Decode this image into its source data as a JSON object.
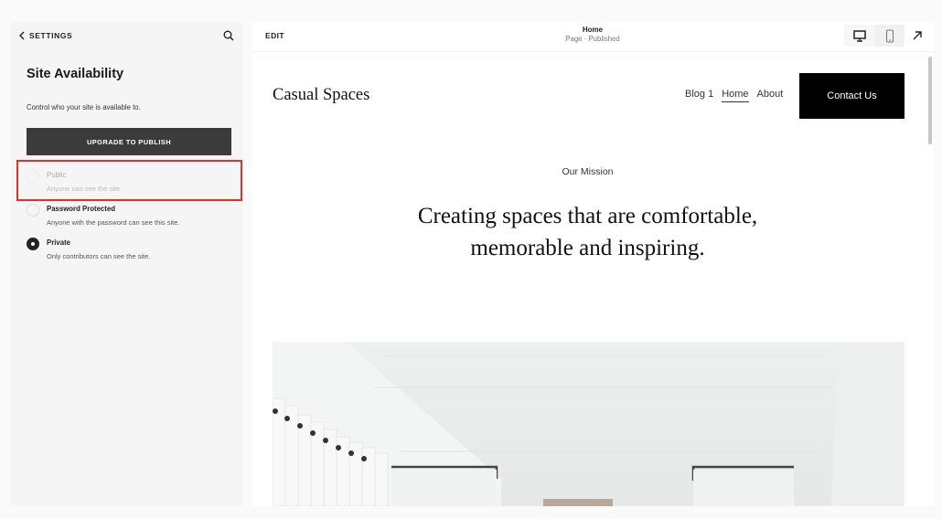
{
  "sidebar": {
    "back_label": "SETTINGS",
    "title": "Site Availability",
    "description": "Control who your site is available to.",
    "upgrade_label": "UPGRADE TO PUBLISH",
    "options": [
      {
        "label": "Public",
        "sublabel": "Anyone can see the site.",
        "checked": false,
        "disabled": true
      },
      {
        "label": "Password Protected",
        "sublabel": "Anyone with the password can see this site.",
        "checked": false,
        "disabled": false
      },
      {
        "label": "Private",
        "sublabel": "Only contributors can see the site.",
        "checked": true,
        "disabled": false
      }
    ],
    "highlight_color": "#e0302a"
  },
  "toolbar": {
    "edit_label": "EDIT",
    "page_name": "Home",
    "page_status": "Page · Published",
    "device_active": "mobile"
  },
  "site": {
    "logo": "Casual Spaces",
    "nav": [
      {
        "label": "Blog 1",
        "active": false
      },
      {
        "label": "Home",
        "active": true
      },
      {
        "label": "About",
        "active": false
      }
    ],
    "cta_label": "Contact Us",
    "mission_label": "Our Mission",
    "mission_heading": "Creating spaces that are comfortable, memorable and inspiring."
  }
}
